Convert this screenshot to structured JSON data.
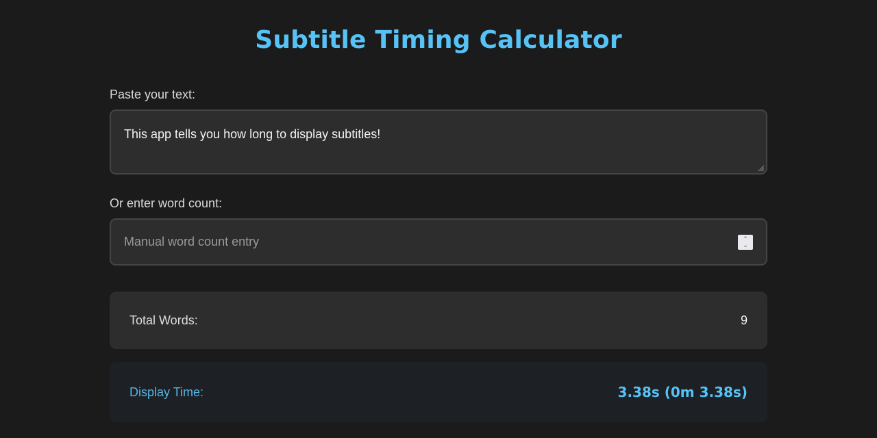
{
  "app": {
    "title": "Subtitle Timing Calculator"
  },
  "text_input": {
    "label": "Paste your text:",
    "value": "This app tells you how long to display subtitles!"
  },
  "word_count_input": {
    "label": "Or enter word count:",
    "placeholder": "Manual word count entry",
    "value": ""
  },
  "results": {
    "total_words_label": "Total Words:",
    "total_words_value": "9",
    "display_time_label": "Display Time:",
    "display_time_value": "3.38s (0m 3.38s)"
  },
  "colors": {
    "background": "#1b1b1c",
    "accent": "#56c2f5",
    "card": "#2d2d2e",
    "highlight_card": "#1d2126"
  },
  "icons": {
    "resize": "resize-grip-icon",
    "spinner": "number-spinner-icon"
  }
}
